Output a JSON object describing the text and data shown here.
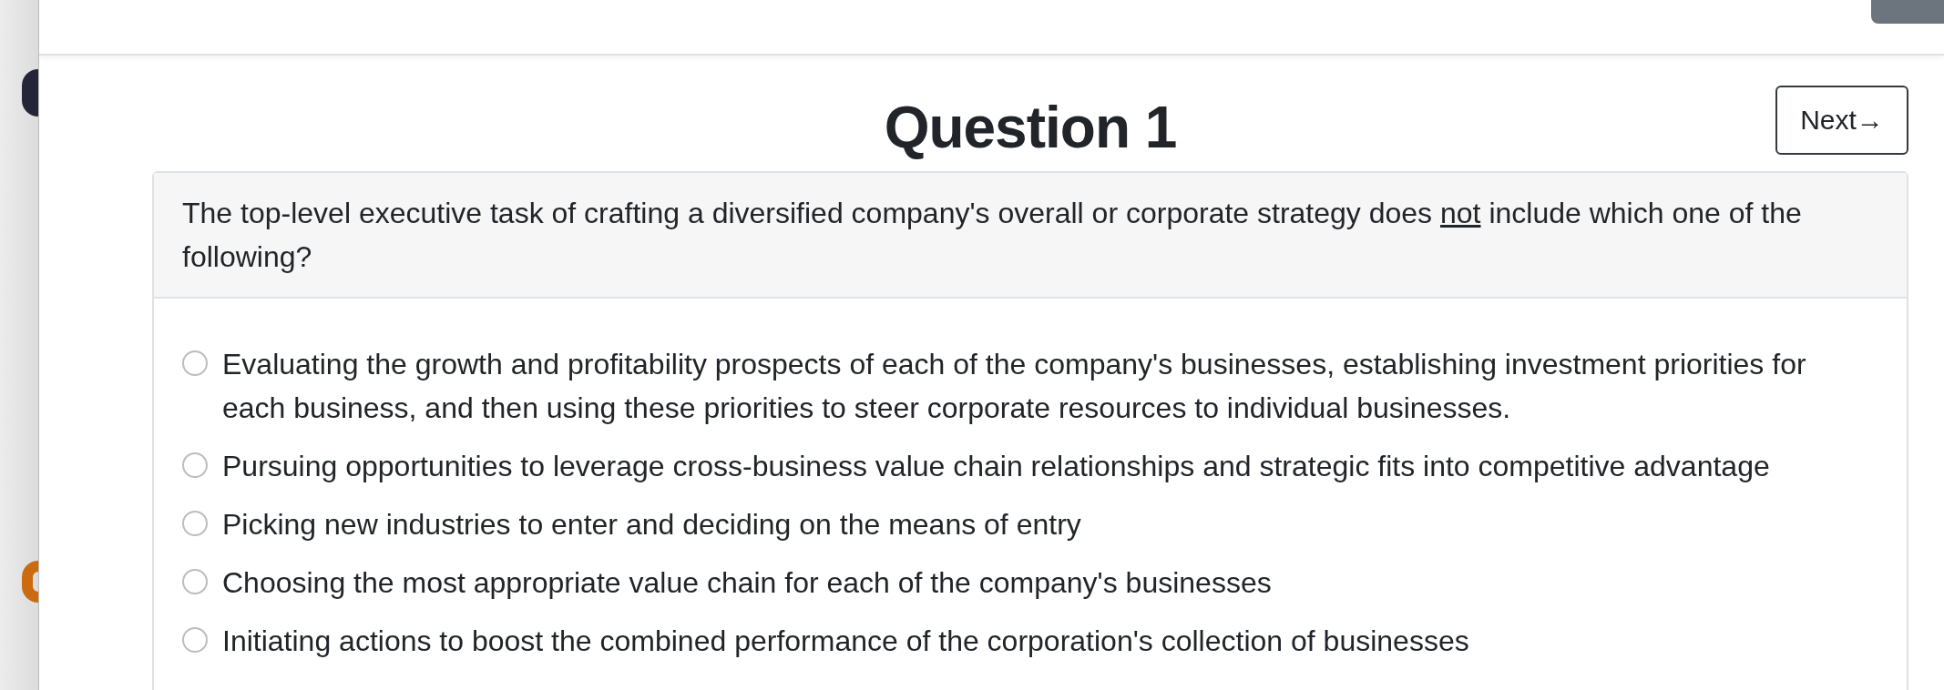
{
  "question": {
    "title": "Question 1",
    "prompt": [
      {
        "text": "The top-level executive task of crafting a diversified company's overall or corporate strategy does ",
        "underlined": false
      },
      {
        "text": "not",
        "underlined": true
      },
      {
        "text": " include which one of the following?",
        "underlined": false
      }
    ]
  },
  "next_button": {
    "label": "Next→"
  },
  "options": [
    {
      "text": "Evaluating the growth and profitability prospects of each of the company's businesses, establishing investment priorities for each business, and then using these priorities to steer corporate resources to individual businesses.",
      "selected": false
    },
    {
      "text": "Pursuing opportunities to leverage cross-business value chain relationships and strategic fits into competitive advantage",
      "selected": false
    },
    {
      "text": "Picking new industries to enter and deciding on the means of entry",
      "selected": false
    },
    {
      "text": "Choosing the most appropriate value chain for each of the company's businesses",
      "selected": false
    },
    {
      "text": "Initiating actions to boost the combined performance of the corporation's collection of businesses",
      "selected": false
    }
  ]
}
